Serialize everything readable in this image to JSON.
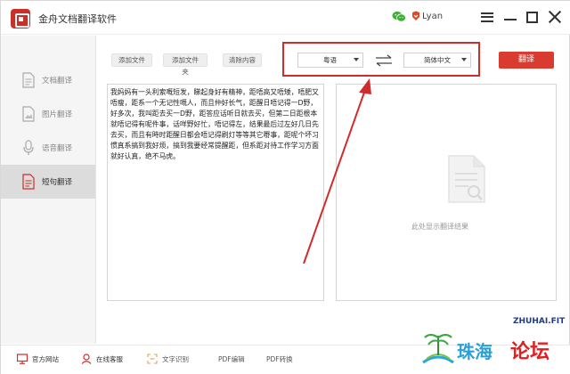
{
  "app": {
    "title": "金舟文档翻译软件",
    "user": "Lyan"
  },
  "sidebar": {
    "items": [
      {
        "label": "文档翻译",
        "icon": "document-icon",
        "active": false
      },
      {
        "label": "图片翻译",
        "icon": "image-icon",
        "active": false
      },
      {
        "label": "语音翻译",
        "icon": "microphone-icon",
        "active": false
      },
      {
        "label": "短句翻译",
        "icon": "sentence-icon",
        "active": true
      }
    ]
  },
  "toolbar": {
    "add_file": "添加文件",
    "add_folder": "添加文件夹",
    "clear": "清除内容",
    "source_lang": "粤语",
    "target_lang": "简体中文",
    "translate": "翻译"
  },
  "source": {
    "text": "我妈妈有一头利索嘅短发，睇起身好有精神，距唔高又唔矮，唔肥又唔瘦，距系一个无记性嘅人，而且仲好长气，距醒日唔记得一D野，好多次，我叫距去买一D野，距答应话听日就去买，但第二日距根本就唔记得有呢件事，话咩野好忙，唔记得左，结果最后过左好几日先去买，而且有時时距醒日都会唔记得刷灯等等其它嘢事，距呢个坏习惯真系搞到我好烦，搞到我要经常提醒距，但系距对待工作学习方面就好认真，绝不马虎。"
  },
  "result": {
    "placeholder": "此处显示翻译结果"
  },
  "footer": {
    "items": [
      {
        "label": "官方网站",
        "icon": "monitor-icon"
      },
      {
        "label": "在线客服",
        "icon": "support-agent-icon"
      },
      {
        "label": "文字识别",
        "icon": "text-recognition-icon"
      },
      {
        "label": "PDF编辑",
        "icon": ""
      },
      {
        "label": "PDF转换",
        "icon": ""
      }
    ]
  },
  "watermark": {
    "domain": "ZHUHAI.FIT",
    "city": "珠海",
    "forum": "论坛"
  },
  "colors": {
    "accent": "#d93b30",
    "highlight_box": "#d12b2b",
    "sidebar_bg": "#f5f5f5",
    "active_item": "#dcdcdc"
  }
}
